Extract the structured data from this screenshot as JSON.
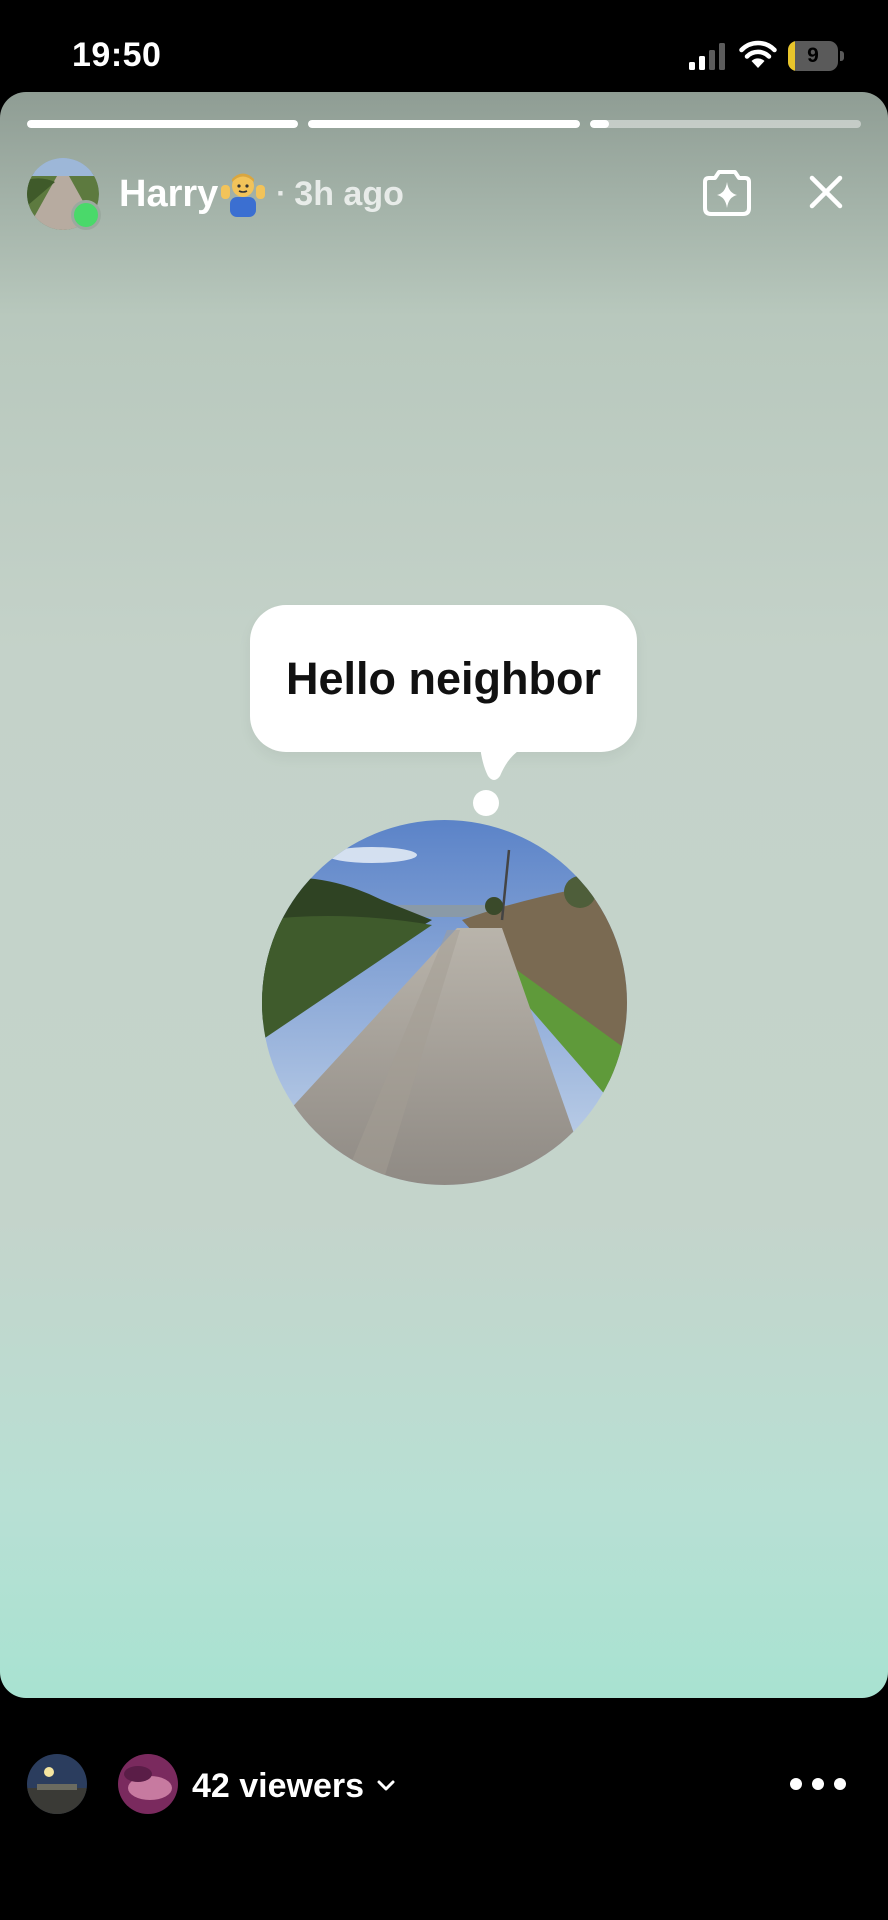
{
  "status_bar": {
    "time": "19:50",
    "battery_level": "9",
    "battery_fraction": 0.14,
    "signal_bars_active": 2
  },
  "story": {
    "progress_segments": [
      1.0,
      1.0,
      0.07
    ],
    "user": {
      "name": "Harry",
      "name_emoji": "person-shrugging",
      "separator": "·",
      "time_ago": "3h ago",
      "online": true
    },
    "actions": {
      "sparkle_icon": "camera-sparkle-icon",
      "close_icon": "close-icon"
    },
    "bubble_text": "Hello neighbor",
    "photo": "country-road-circle-photo"
  },
  "footer": {
    "viewers_label": "42 viewers",
    "more_icon": "ellipsis-icon"
  },
  "colors": {
    "online": "#4ad96a",
    "bg_top": "#8f9d94",
    "bg_bottom": "#a8e2d1",
    "battery": "#e8c52b"
  }
}
